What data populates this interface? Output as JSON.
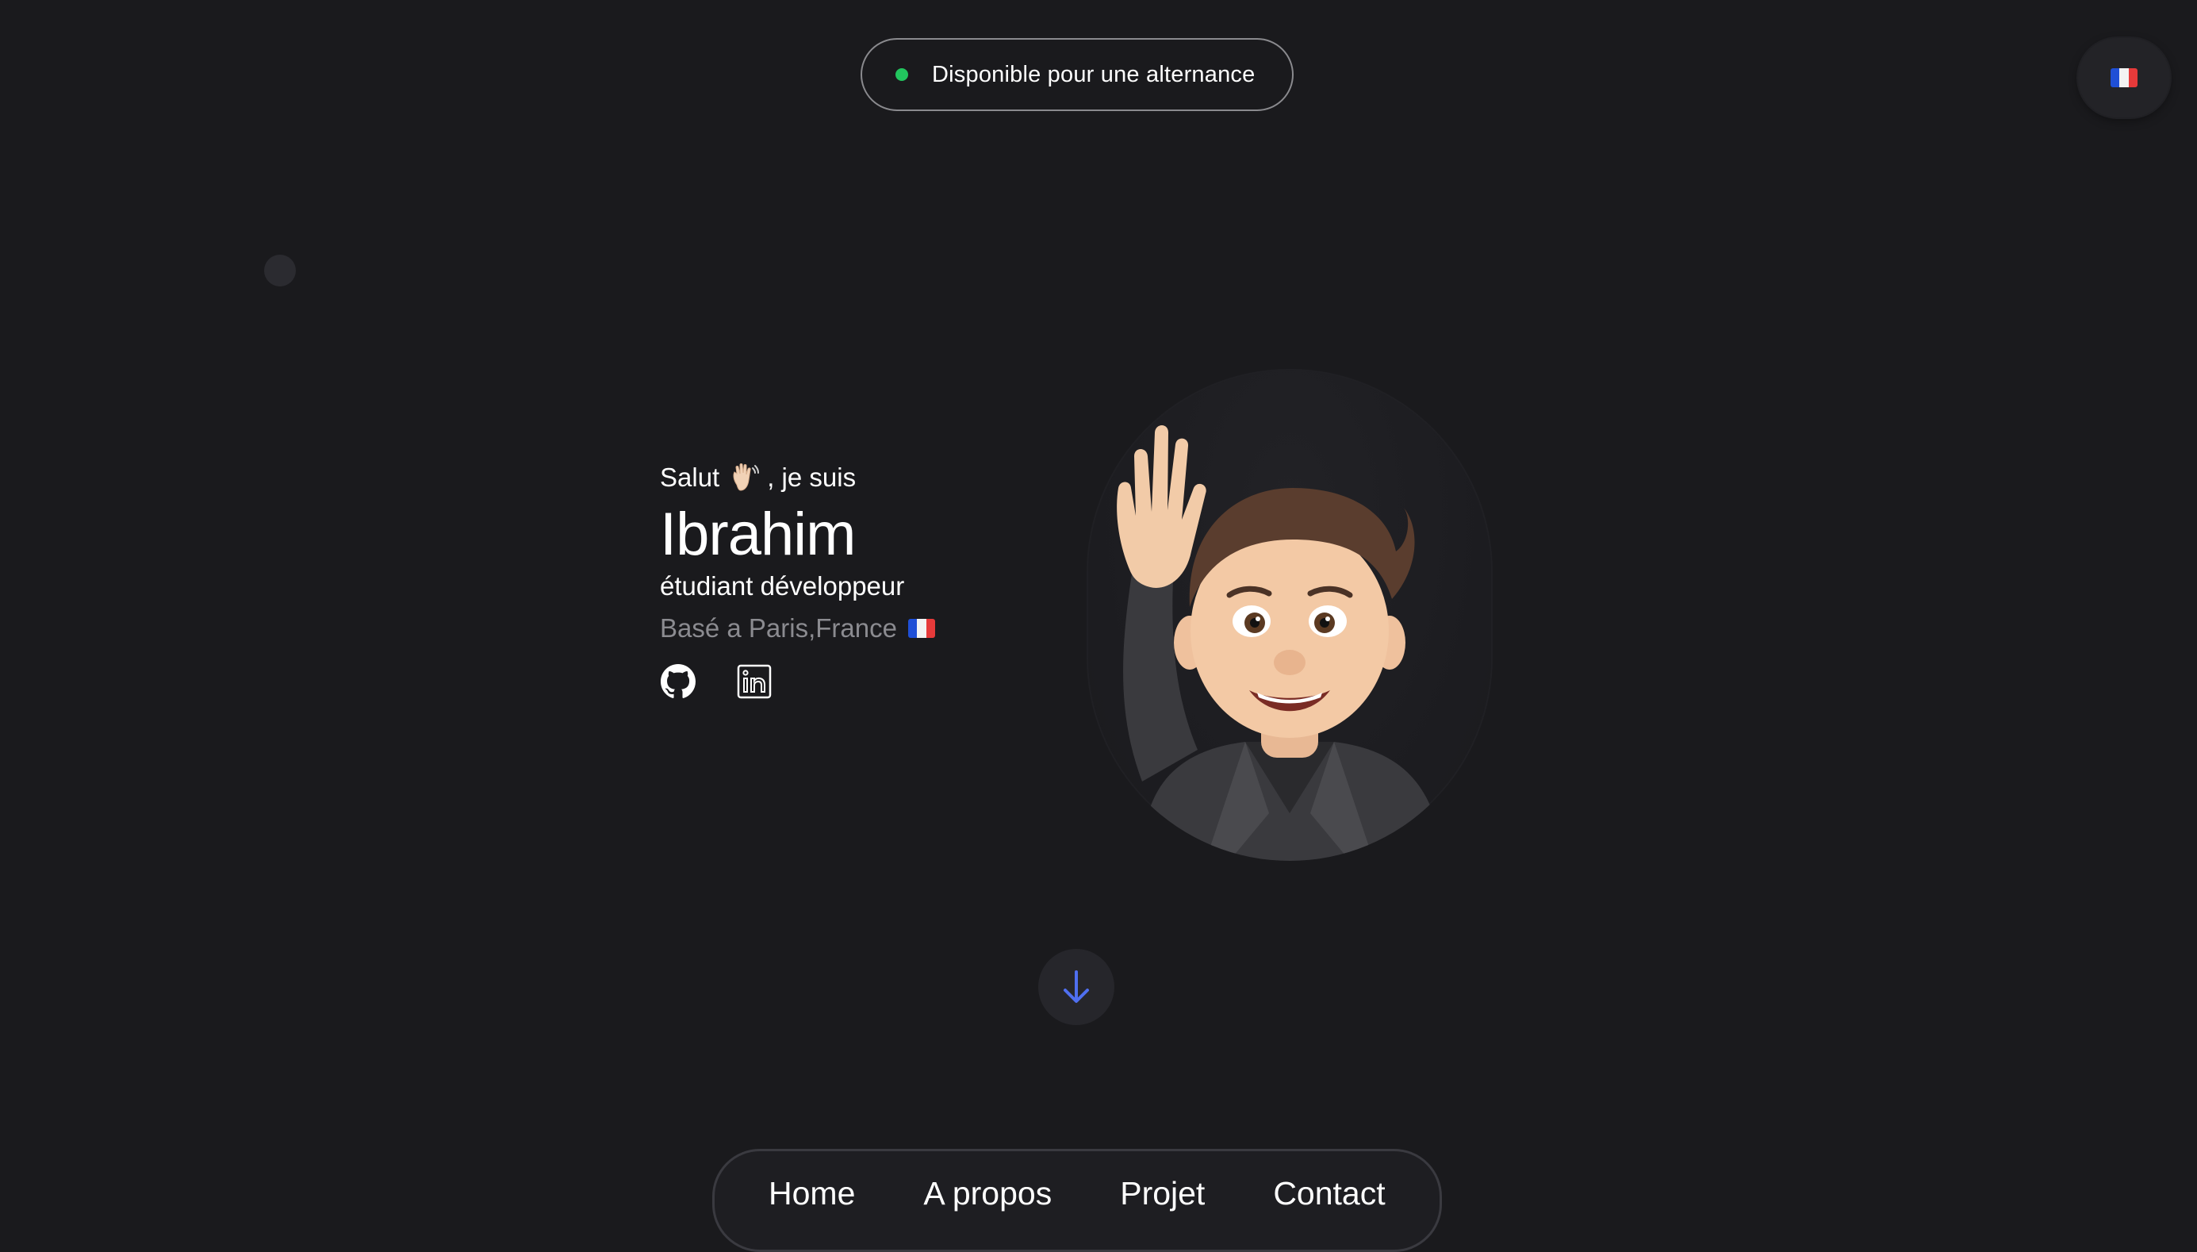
{
  "status": {
    "label": "Disponible pour une alternance",
    "dot_color": "#22c55e"
  },
  "language": {
    "flag_icon": "flag-fr-icon",
    "flag_colors": [
      "#1f4fd6",
      "#f3f3f3",
      "#e63a3a"
    ]
  },
  "intro": {
    "greeting_before": "Salut",
    "greeting_after": ", je suis",
    "name": "Ibrahim",
    "role": "étudiant développeur",
    "location": "Basé a Paris,France"
  },
  "socials": [
    {
      "icon": "github-icon"
    },
    {
      "icon": "linkedin-icon"
    }
  ],
  "scroll": {
    "icon": "arrow-down-icon",
    "color": "#4f6ff0"
  },
  "nav": {
    "items": [
      {
        "label": "Home"
      },
      {
        "label": "A propos"
      },
      {
        "label": "Projet"
      },
      {
        "label": "Contact"
      }
    ]
  }
}
